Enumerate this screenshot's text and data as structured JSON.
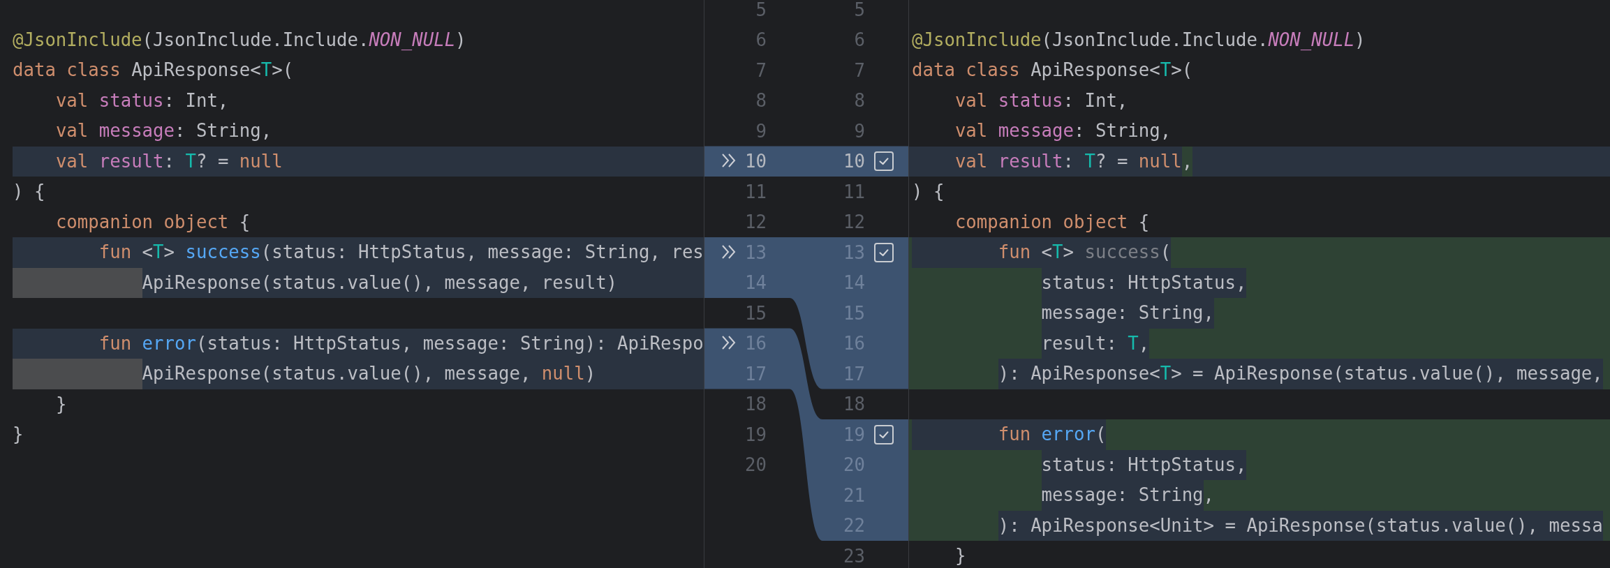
{
  "rows": [
    {
      "caret": false,
      "left": {
        "number": "5",
        "kind": "plain"
      },
      "right": {
        "number": "5",
        "kind": "plain"
      }
    },
    {
      "caret": false,
      "left": {
        "number": "6",
        "kind": "plain",
        "segments": [
          {
            "kind": "plain",
            "tokens": [
              {
                "text": "@JsonInclude",
                "kind": "annotation"
              },
              {
                "text": "(JsonInclude.Include."
              },
              {
                "text": "NON_NULL",
                "kind": "constant"
              },
              {
                "text": ")"
              }
            ]
          }
        ]
      },
      "right": {
        "number": "6",
        "kind": "plain",
        "segments": [
          {
            "kind": "plain",
            "tokens": [
              {
                "text": "@JsonInclude",
                "kind": "annotation"
              },
              {
                "text": "(JsonInclude.Include."
              },
              {
                "text": "NON_NULL",
                "kind": "constant"
              },
              {
                "text": ")"
              }
            ]
          }
        ]
      }
    },
    {
      "caret": false,
      "left": {
        "number": "7",
        "kind": "plain",
        "segments": [
          {
            "kind": "plain",
            "tokens": [
              {
                "text": "data class ",
                "kind": "keyword"
              },
              {
                "text": "ApiResponse<"
              },
              {
                "text": "T",
                "kind": "type_param"
              },
              {
                "text": ">("
              }
            ]
          }
        ]
      },
      "right": {
        "number": "7",
        "kind": "plain",
        "segments": [
          {
            "kind": "plain",
            "tokens": [
              {
                "text": "data class ",
                "kind": "keyword"
              },
              {
                "text": "ApiResponse<"
              },
              {
                "text": "T",
                "kind": "type_param"
              },
              {
                "text": ">("
              }
            ]
          }
        ]
      }
    },
    {
      "caret": false,
      "left": {
        "number": "8",
        "kind": "plain",
        "segments": [
          {
            "kind": "plain",
            "tokens": [
              {
                "text": "    val ",
                "kind": "keyword"
              },
              {
                "text": "status",
                "kind": "property"
              },
              {
                "text": ": Int,"
              }
            ]
          }
        ]
      },
      "right": {
        "number": "8",
        "kind": "plain",
        "segments": [
          {
            "kind": "plain",
            "tokens": [
              {
                "text": "    val ",
                "kind": "keyword"
              },
              {
                "text": "status",
                "kind": "property"
              },
              {
                "text": ": Int,"
              }
            ]
          }
        ]
      }
    },
    {
      "caret": false,
      "left": {
        "number": "9",
        "kind": "plain",
        "segments": [
          {
            "kind": "plain",
            "tokens": [
              {
                "text": "    val ",
                "kind": "keyword"
              },
              {
                "text": "message",
                "kind": "property"
              },
              {
                "text": ": String,"
              }
            ]
          }
        ]
      },
      "right": {
        "number": "9",
        "kind": "plain",
        "segments": [
          {
            "kind": "plain",
            "tokens": [
              {
                "text": "    val ",
                "kind": "keyword"
              },
              {
                "text": "message",
                "kind": "property"
              },
              {
                "text": ": String,"
              }
            ]
          }
        ]
      }
    },
    {
      "caret": true,
      "apply_arrow": true,
      "checkbox": {
        "checked": true
      },
      "left": {
        "number": "10",
        "kind": "modified",
        "segments": [
          {
            "kind": "plain",
            "tokens": [
              {
                "text": "    val ",
                "kind": "keyword"
              },
              {
                "text": "result",
                "kind": "property"
              },
              {
                "text": ": "
              },
              {
                "text": "T",
                "kind": "type_param"
              },
              {
                "text": "? = "
              },
              {
                "text": "null",
                "kind": "keyword"
              }
            ]
          }
        ]
      },
      "right": {
        "number": "10",
        "kind": "modified",
        "segments": [
          {
            "kind": "plain",
            "tokens": [
              {
                "text": "    val ",
                "kind": "keyword"
              },
              {
                "text": "result",
                "kind": "property"
              },
              {
                "text": ": "
              },
              {
                "text": "T",
                "kind": "type_param"
              },
              {
                "text": "? = "
              },
              {
                "text": "null",
                "kind": "keyword"
              }
            ]
          },
          {
            "kind": "added",
            "tokens": [
              {
                "text": ","
              }
            ]
          }
        ]
      }
    },
    {
      "caret": false,
      "left": {
        "number": "11",
        "kind": "plain",
        "segments": [
          {
            "kind": "plain",
            "tokens": [
              {
                "text": ") {"
              }
            ]
          }
        ]
      },
      "right": {
        "number": "11",
        "kind": "plain",
        "segments": [
          {
            "kind": "plain",
            "tokens": [
              {
                "text": ") {"
              }
            ]
          }
        ]
      }
    },
    {
      "caret": false,
      "left": {
        "number": "12",
        "kind": "plain",
        "segments": [
          {
            "kind": "plain",
            "tokens": [
              {
                "text": "    companion object ",
                "kind": "keyword"
              },
              {
                "text": "{"
              }
            ]
          }
        ]
      },
      "right": {
        "number": "12",
        "kind": "plain",
        "segments": [
          {
            "kind": "plain",
            "tokens": [
              {
                "text": "    companion object ",
                "kind": "keyword"
              },
              {
                "text": "{"
              }
            ]
          }
        ]
      }
    },
    {
      "caret": false,
      "apply_arrow": true,
      "checkbox": {
        "checked": true
      },
      "left": {
        "number": "13",
        "kind": "modified",
        "segments": [
          {
            "kind": "plain",
            "tokens": [
              {
                "text": "        fun ",
                "kind": "keyword"
              },
              {
                "text": "<"
              },
              {
                "text": "T",
                "kind": "type_param"
              },
              {
                "text": "> "
              },
              {
                "text": "success",
                "kind": "function"
              },
              {
                "text": "(status: HttpStatus, message: String, res"
              }
            ]
          }
        ]
      },
      "right": {
        "number": "13",
        "kind": "inserted",
        "segments": [
          {
            "kind": "sameline",
            "tokens": [
              {
                "text": "        fun ",
                "kind": "keyword"
              },
              {
                "text": "<"
              },
              {
                "text": "T",
                "kind": "type_param"
              },
              {
                "text": "> "
              },
              {
                "text": "success",
                "kind": "unused"
              },
              {
                "text": "("
              }
            ]
          }
        ]
      }
    },
    {
      "caret": false,
      "left": {
        "number": "14",
        "kind": "modified",
        "segments": [
          {
            "kind": "reindented",
            "tokens": [
              {
                "text": "            ApiResponse(status.value(), message, result)"
              }
            ]
          }
        ]
      },
      "right": {
        "number": "14",
        "kind": "inserted",
        "segments": [
          {
            "kind": "same",
            "tokens": [
              {
                "text": "            status: HttpStatus,"
              }
            ]
          }
        ]
      }
    },
    {
      "caret": false,
      "left": {
        "number": "15",
        "kind": "plain"
      },
      "right": {
        "number": "15",
        "kind": "inserted",
        "segments": [
          {
            "kind": "same",
            "tokens": [
              {
                "text": "            message: String,"
              }
            ]
          }
        ]
      }
    },
    {
      "caret": false,
      "apply_arrow": true,
      "left": {
        "number": "16",
        "kind": "modified",
        "segments": [
          {
            "kind": "plain",
            "tokens": [
              {
                "text": "        fun ",
                "kind": "keyword"
              },
              {
                "text": "error",
                "kind": "function"
              },
              {
                "text": "(status: HttpStatus, message: String): ApiRespo"
              }
            ]
          }
        ]
      },
      "right": {
        "number": "16",
        "kind": "inserted",
        "segments": [
          {
            "kind": "same",
            "tokens": [
              {
                "text": "            result: "
              },
              {
                "text": "T",
                "kind": "type_param"
              },
              {
                "text": ","
              }
            ]
          }
        ]
      }
    },
    {
      "caret": false,
      "left": {
        "number": "17",
        "kind": "modified",
        "segments": [
          {
            "kind": "reindented",
            "tokens": [
              {
                "text": "            ApiResponse(status.value(), message, "
              },
              {
                "text": "null",
                "kind": "keyword"
              },
              {
                "text": ")"
              }
            ]
          }
        ]
      },
      "right": {
        "number": "17",
        "kind": "inserted",
        "segments": [
          {
            "kind": "same",
            "tokens": [
              {
                "text": "        ): ApiResponse<"
              },
              {
                "text": "T",
                "kind": "type_param"
              },
              {
                "text": "> = ApiResponse(status.value(), message,"
              }
            ]
          }
        ]
      }
    },
    {
      "caret": false,
      "left": {
        "number": "18",
        "kind": "plain",
        "segments": [
          {
            "kind": "plain",
            "tokens": [
              {
                "text": "    }"
              }
            ]
          }
        ]
      },
      "right": {
        "number": "18",
        "kind": "plain"
      }
    },
    {
      "caret": false,
      "checkbox": {
        "checked": true
      },
      "left": {
        "number": "19",
        "kind": "plain",
        "segments": [
          {
            "kind": "plain",
            "tokens": [
              {
                "text": "}"
              }
            ]
          }
        ]
      },
      "right": {
        "number": "19",
        "kind": "inserted",
        "segments": [
          {
            "kind": "sameline",
            "tokens": [
              {
                "text": "        fun ",
                "kind": "keyword"
              },
              {
                "text": "error",
                "kind": "function"
              },
              {
                "text": "("
              }
            ]
          }
        ]
      }
    },
    {
      "caret": false,
      "left": {
        "number": "20",
        "kind": "plain"
      },
      "right": {
        "number": "20",
        "kind": "inserted",
        "segments": [
          {
            "kind": "same",
            "tokens": [
              {
                "text": "            status: HttpStatus,"
              }
            ]
          }
        ]
      }
    },
    {
      "caret": false,
      "left": {
        "kind": "plain"
      },
      "right": {
        "number": "21",
        "kind": "inserted",
        "segments": [
          {
            "kind": "same",
            "tokens": [
              {
                "text": "            message: String"
              }
            ]
          },
          {
            "kind": "plain",
            "tokens": [
              {
                "text": ","
              }
            ]
          }
        ]
      }
    },
    {
      "caret": false,
      "left": {
        "kind": "plain"
      },
      "right": {
        "number": "22",
        "kind": "inserted",
        "segments": [
          {
            "kind": "same",
            "tokens": [
              {
                "text": "        ): ApiResponse<Unit> = ApiResponse(status.value(), messa"
              }
            ]
          }
        ]
      }
    },
    {
      "caret": false,
      "left": {
        "kind": "plain"
      },
      "right": {
        "number": "23",
        "kind": "plain",
        "segments": [
          {
            "kind": "plain",
            "tokens": [
              {
                "text": "    }"
              }
            ]
          }
        ]
      }
    }
  ]
}
